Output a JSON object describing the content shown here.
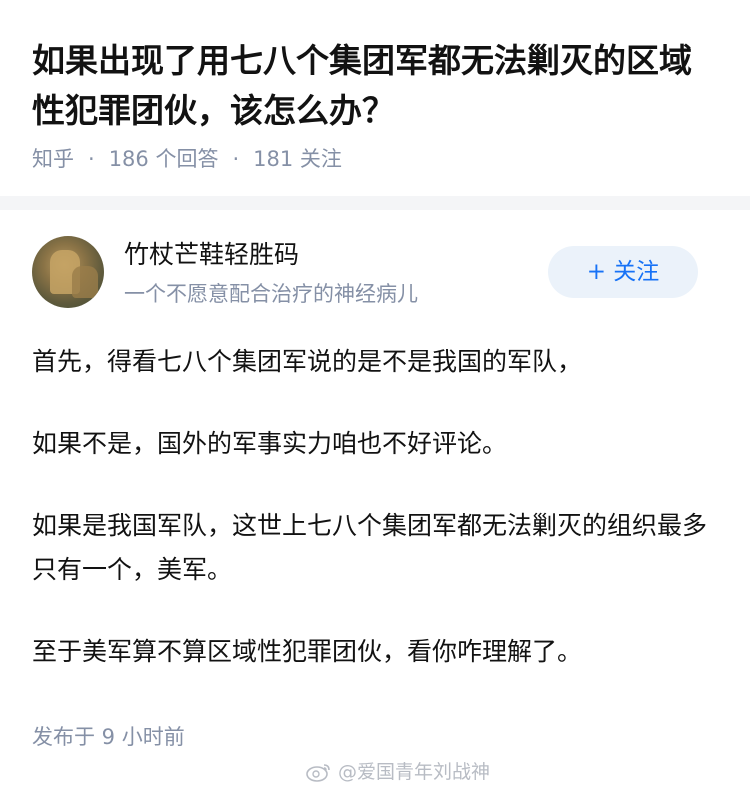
{
  "question": {
    "title": "如果出现了用七八个集团军都无法剿灭的区域性犯罪团伙，该怎么办？",
    "source": "知乎",
    "answers": "186 个回答",
    "followers": "181 关注"
  },
  "author": {
    "name": "竹杖芒鞋轻胜码",
    "bio": "一个不愿意配合治疗的神经病儿",
    "follow_label": "+ 关注"
  },
  "answer": {
    "paragraphs": [
      "首先，得看七八个集团军说的是不是我国的军队，",
      "如果不是，国外的军事实力咱也不好评论。",
      "如果是我国军队，这世上七八个集团军都无法剿灭的组织最多只有一个，美军。",
      "至于美军算不算区域性犯罪团伙，看你咋理解了。"
    ],
    "published": "发布于 9 小时前"
  },
  "watermark": {
    "text": "@爱国青年刘战神",
    "icon": "weibo-icon"
  }
}
